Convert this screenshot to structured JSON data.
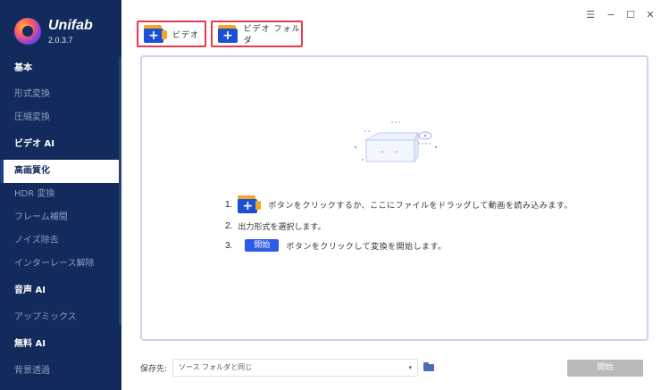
{
  "app": {
    "name": "Unifab",
    "version": "2.0.3.7"
  },
  "sidebar": {
    "sections": [
      {
        "label": "基本",
        "type": "header"
      },
      {
        "label": "形式変換",
        "type": "item"
      },
      {
        "label": "圧縮変換",
        "type": "item"
      },
      {
        "label": "ビデオ AI",
        "type": "header"
      },
      {
        "label": "高画質化",
        "type": "active"
      },
      {
        "label": "HDR 変換",
        "type": "item"
      },
      {
        "label": "フレーム補間",
        "type": "item"
      },
      {
        "label": "ノイズ除去",
        "type": "item"
      },
      {
        "label": "インターレース解除",
        "type": "item"
      },
      {
        "label": "音声 AI",
        "type": "header"
      },
      {
        "label": "アップミックス",
        "type": "item"
      },
      {
        "label": "無料 AI",
        "type": "header"
      },
      {
        "label": "背景透過",
        "type": "item"
      }
    ]
  },
  "toolbar": {
    "add_video_label": "ビデオ",
    "add_folder_label": "ビデオ フォルダ",
    "plus": "+"
  },
  "window_controls": {
    "menu": "☰",
    "minimize": "−",
    "maximize": "☐",
    "close": "✕"
  },
  "instructions": {
    "step1_num": "1.",
    "step1_text": "ボタンをクリックするか、ここにファイルをドラッグして動画を読み込みます。",
    "step2_num": "2.",
    "step2_text": "出力形式を選択します。",
    "step3_num": "3.",
    "step3_chip": "開始",
    "step3_text": "ボタンをクリックして変換を開始します。"
  },
  "footer": {
    "save_label": "保存先:",
    "save_value": "ソース フォルダと同じ",
    "caret": "▾",
    "start_label": "開始"
  },
  "colors": {
    "sidebar_bg": "#122a5c",
    "accent": "#2e5ce6",
    "highlight_border": "#e8384f"
  }
}
